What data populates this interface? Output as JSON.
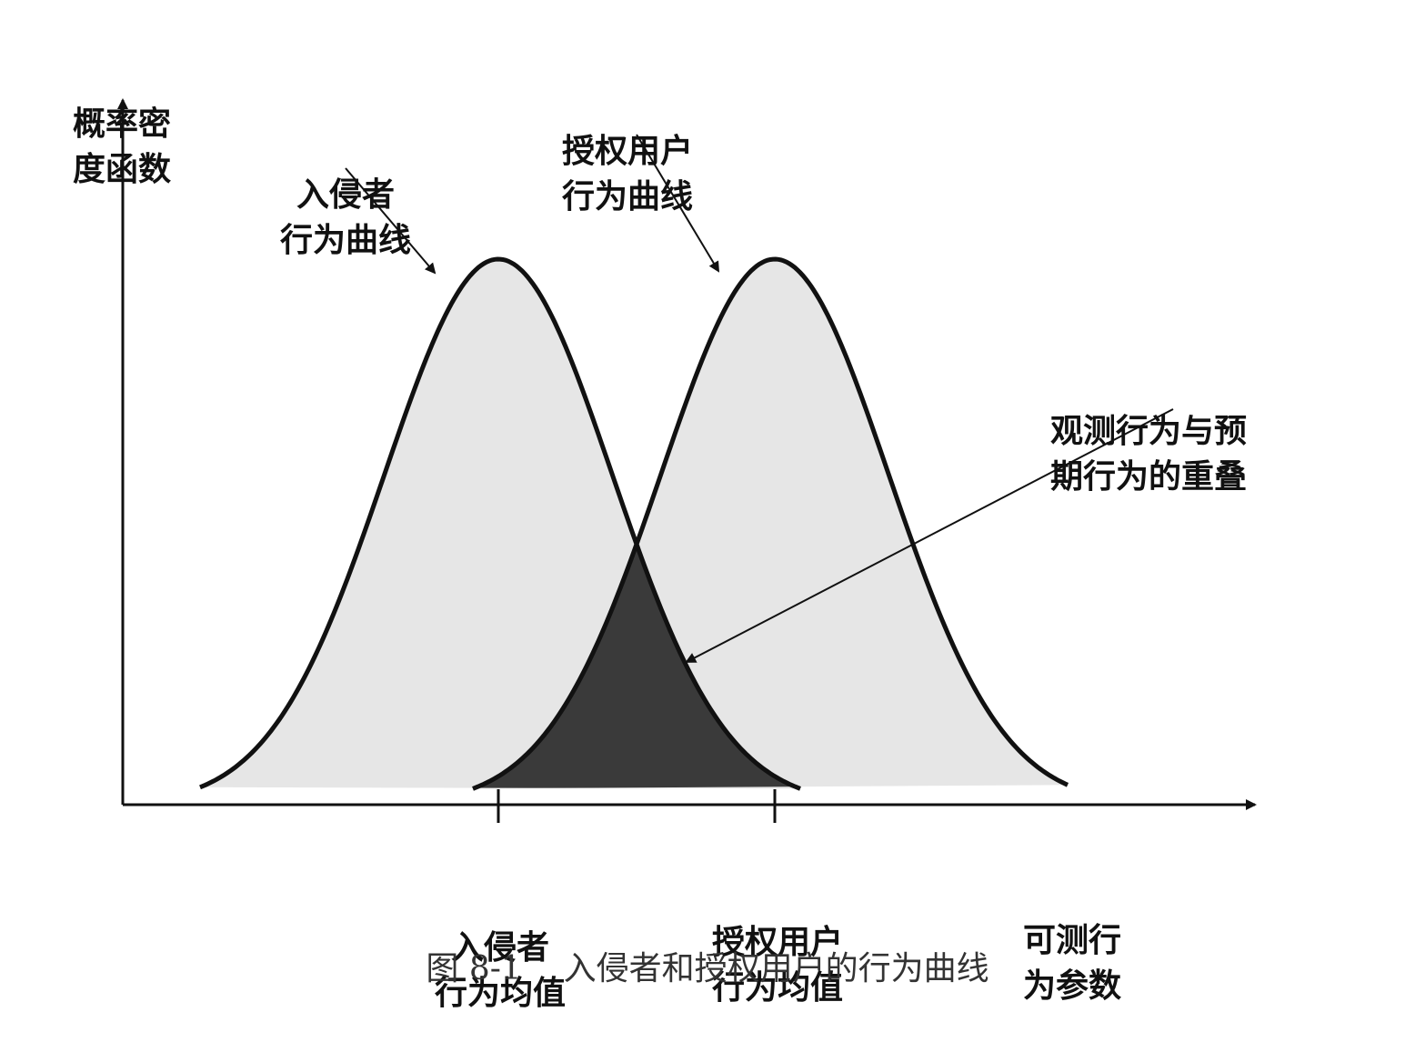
{
  "y_axis_label": [
    "概率密",
    "度函数"
  ],
  "x_axis_label": [
    "可测行",
    "为参数"
  ],
  "intruder_curve_label": [
    "入侵者",
    "行为曲线"
  ],
  "authorized_curve_label": [
    "授权用户",
    "行为曲线"
  ],
  "overlap_label": [
    "观测行为与预",
    "期行为的重叠"
  ],
  "intruder_mean_label": [
    "入侵者",
    "行为均值"
  ],
  "authorized_mean_label": [
    "授权用户",
    "行为均值"
  ],
  "caption": {
    "number": "图 8-1",
    "title": "入侵者和授权用户的行为曲线"
  },
  "colors": {
    "curve_fill": "#e6e6e6",
    "overlap_fill": "#3a3a3a",
    "stroke": "#111111"
  }
}
